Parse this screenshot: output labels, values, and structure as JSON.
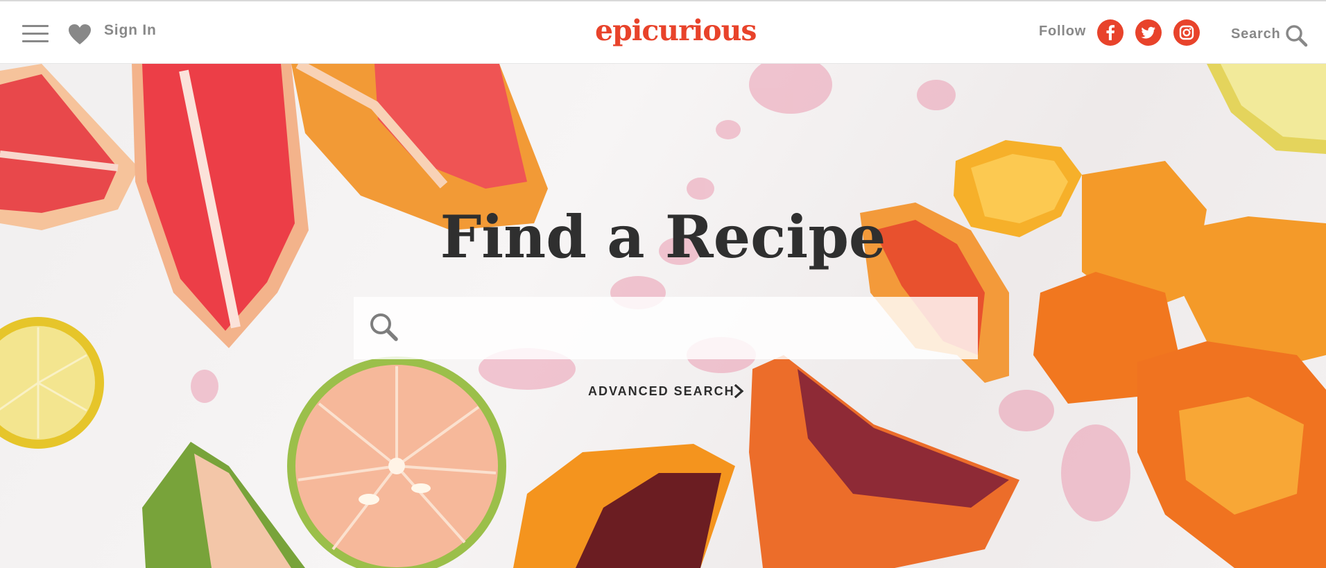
{
  "header": {
    "sign_in_label": "Sign In",
    "logo_text": "epicurious",
    "follow_label": "Follow",
    "search_label": "Search",
    "social_icons": [
      "facebook-icon",
      "twitter-icon",
      "instagram-icon"
    ],
    "brand_color": "#e8432b"
  },
  "hero": {
    "title": "Find a Recipe",
    "search_placeholder": "",
    "search_value": "",
    "advanced_search_label": "ADVANCED SEARCH"
  }
}
